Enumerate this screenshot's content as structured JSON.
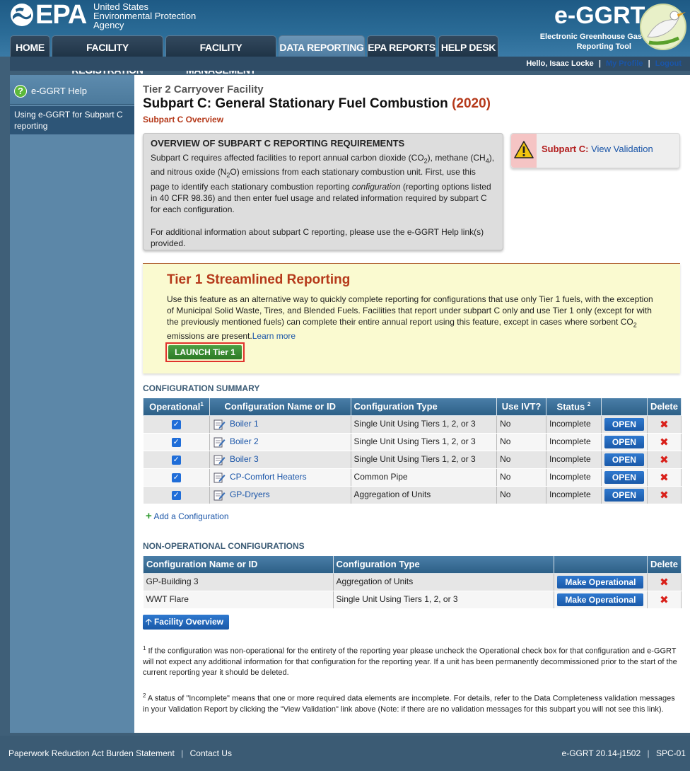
{
  "header": {
    "epa_word": "EPA",
    "agency_lines": [
      "United States",
      "Environmental Protection",
      "Agency"
    ],
    "app_name": "e-GGRT",
    "app_sub1": "Electronic Greenhouse Gas",
    "app_sub2": "Reporting Tool"
  },
  "nav": [
    "HOME",
    "FACILITY REGISTRATION",
    "FACILITY MANAGEMENT",
    "DATA REPORTING",
    "EPA REPORTS",
    "HELP DESK"
  ],
  "userbar": {
    "greeting": "Hello, Isaac Locke",
    "profile": "My Profile",
    "logout": "Logout"
  },
  "sidebar": {
    "help_label": "e-GGRT Help",
    "help_icon": "question-icon",
    "help_link": "Using e-GGRT for Subpart C reporting"
  },
  "page": {
    "facility": "Tier 2 Carryover Facility",
    "title": "Subpart C: General Stationary Fuel Combustion",
    "year": "(2020)",
    "subtitle": "Subpart C Overview"
  },
  "overview": {
    "title": "OVERVIEW OF SUBPART C REPORTING REQUIREMENTS",
    "p1_a": "Subpart C requires affected facilities to report annual carbon dioxide (CO",
    "p1_b": "), methane (CH",
    "p1_c": "), and nitrous oxide (N",
    "p1_d": "O) emissions from each stationary combustion unit. First, use this page to identify each stationary combustion reporting ",
    "p1_e": "configuration",
    "p1_f": " (reporting options listed in 40 CFR 98.36) and then enter fuel usage and related information required by subpart C for each configuration.",
    "sub2": "2",
    "sub4": "4",
    "p2": "For additional information about subpart C reporting, please use the e-GGRT Help link(s) provided."
  },
  "validation": {
    "label": "Subpart C:",
    "link": "View Validation",
    "icon": "warning-icon"
  },
  "tier1": {
    "title": "Tier 1 Streamlined Reporting",
    "text_a": "Use this feature as an alternative way to quickly complete reporting for configurations that use only Tier 1 fuels, with the exception of Municipal Solid Waste, Tires, and Blended Fuels. Facilities that report under subpart C only and use Tier 1 only (except for with the previously mentioned fuels) can complete their entire annual report using this feature, except in cases where sorbent CO",
    "text_sub": "2",
    "text_b": " emissions are present.",
    "learn_more": "Learn more",
    "launch": "LAUNCH Tier 1"
  },
  "config_summary": {
    "heading": "CONFIGURATION SUMMARY",
    "columns": [
      "Operational",
      "Configuration Name or ID",
      "Configuration Type",
      "Use IVT?",
      "Status",
      "",
      "Delete"
    ],
    "op_sup": "1",
    "status_sup": "2",
    "rows": [
      {
        "name": "Boiler 1",
        "type": "Single Unit Using Tiers 1, 2, or 3",
        "ivt": "No",
        "status": "Incomplete",
        "action": "OPEN"
      },
      {
        "name": "Boiler 2",
        "type": "Single Unit Using Tiers 1, 2, or 3",
        "ivt": "No",
        "status": "Incomplete",
        "action": "OPEN"
      },
      {
        "name": "Boiler 3",
        "type": "Single Unit Using Tiers 1, 2, or 3",
        "ivt": "No",
        "status": "Incomplete",
        "action": "OPEN"
      },
      {
        "name": "CP-Comfort Heaters",
        "type": "Common Pipe",
        "ivt": "No",
        "status": "Incomplete",
        "action": "OPEN"
      },
      {
        "name": "GP-Dryers",
        "type": "Aggregation of Units",
        "ivt": "No",
        "status": "Incomplete",
        "action": "OPEN"
      }
    ],
    "add_label": "Add a Configuration"
  },
  "non_operational": {
    "heading": "NON-OPERATIONAL CONFIGURATIONS",
    "columns": [
      "Configuration Name or ID",
      "Configuration Type",
      "",
      "Delete"
    ],
    "rows": [
      {
        "name": "GP-Building 3",
        "type": "Aggregation of Units",
        "action": "Make Operational"
      },
      {
        "name": "WWT Flare",
        "type": "Single Unit Using Tiers 1, 2, or 3",
        "action": "Make Operational"
      }
    ]
  },
  "facility_overview_btn": "Facility Overview",
  "footnotes": {
    "n1_sup": "1",
    "n1": " If the configuration was non-operational for the entirety of the reporting year please uncheck the Operational check box for that configuration and e-GGRT will not expect any additional information for that configuration for the reporting year. If a unit has been permanently decommissioned prior to the start of the current reporting year it should be deleted.",
    "n2_sup": "2",
    "n2": " A status of \"Incomplete\" means that one or more required data elements are incomplete. For details, refer to the Data Completeness validation messages in your Validation Report by clicking the \"View Validation\" link above (Note: if there are no validation messages for this subpart you will not see this link)."
  },
  "footer": {
    "paperwork": "Paperwork Reduction Act Burden Statement",
    "contact": "Contact Us",
    "version": "e-GGRT 20.14-j1502",
    "code": "SPC-01"
  }
}
